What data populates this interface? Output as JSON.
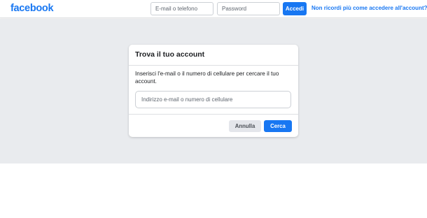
{
  "header": {
    "logo": "facebook",
    "email_placeholder": "E-mail o telefono",
    "password_placeholder": "Password",
    "login_label": "Accedi",
    "forgot_label": "Non ricordi più come accedere all'account?"
  },
  "dialog": {
    "title": "Trova il tuo account",
    "instructions": "Inserisci l'e-mail o il numero di cellulare per cercare il tuo account.",
    "search_placeholder": "Indirizzo e-mail o numero di cellulare",
    "search_value": "",
    "cancel_label": "Annulla",
    "search_label": "Cerca"
  },
  "colors": {
    "brand": "#1877f2",
    "page_background": "#e9ebee",
    "cancel_button": "#e4e6eb"
  }
}
